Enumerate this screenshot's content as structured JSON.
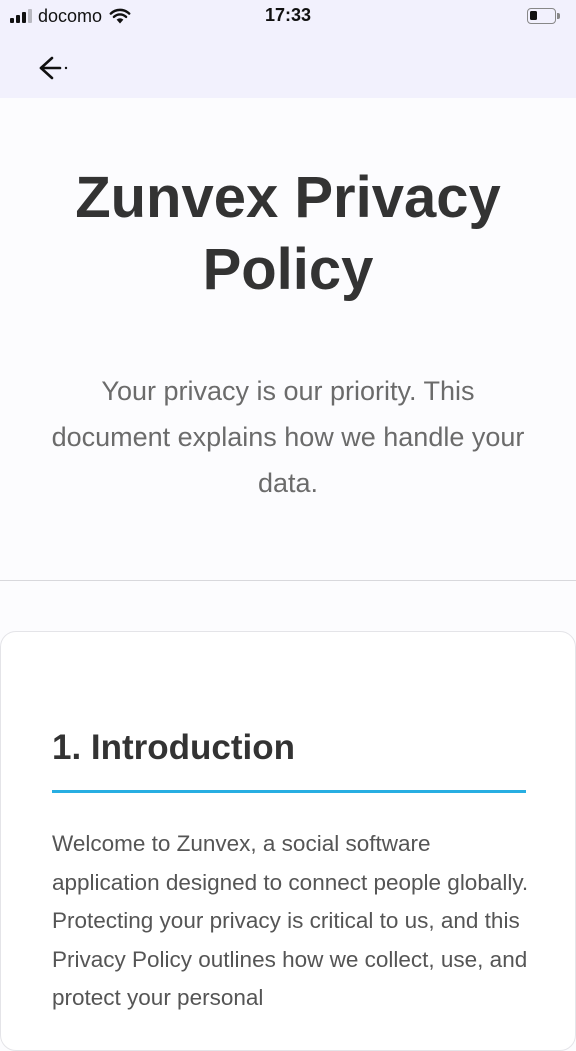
{
  "status_bar": {
    "carrier": "docomo",
    "time": "17:33",
    "signal_bars_active": 3,
    "signal_bars_total": 4,
    "battery_level": 0.3,
    "icons": [
      "signal-icon",
      "wifi-icon",
      "battery-icon"
    ]
  },
  "app_bar": {
    "back_icon": "arrow-left-icon"
  },
  "hero": {
    "title": "Zunvex Privacy Policy",
    "subtitle": "Your privacy is our priority. This document explains how we handle your data."
  },
  "sections": [
    {
      "heading": "1. Introduction",
      "body": "Welcome to Zunvex, a social software application designed to connect people globally. Protecting your privacy is critical to us, and this Privacy Policy outlines how we collect, use, and protect your personal"
    }
  ],
  "colors": {
    "header_background": "#f2f1fd",
    "page_background": "#fcfcfe",
    "accent_rule": "#27aee2",
    "title_text": "#333333",
    "subtitle_text": "#6b6b6b"
  }
}
